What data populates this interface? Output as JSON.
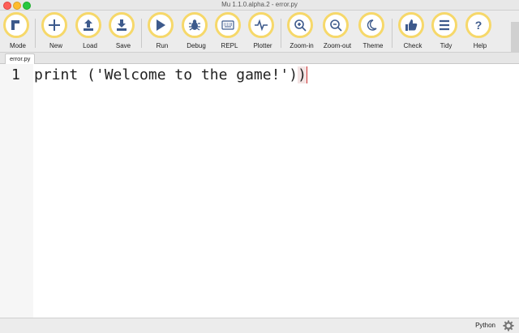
{
  "window": {
    "title": "Mu 1.1.0.alpha.2 - error.py"
  },
  "toolbar": {
    "buttons": [
      {
        "id": "mode",
        "label": "Mode",
        "icon": "mode-icon"
      },
      {
        "id": "new",
        "label": "New",
        "icon": "plus-icon"
      },
      {
        "id": "load",
        "label": "Load",
        "icon": "upload-icon"
      },
      {
        "id": "save",
        "label": "Save",
        "icon": "download-icon"
      },
      {
        "id": "run",
        "label": "Run",
        "icon": "play-icon"
      },
      {
        "id": "debug",
        "label": "Debug",
        "icon": "bug-icon"
      },
      {
        "id": "repl",
        "label": "REPL",
        "icon": "keyboard-icon"
      },
      {
        "id": "plotter",
        "label": "Plotter",
        "icon": "pulse-icon"
      },
      {
        "id": "zoom-in",
        "label": "Zoom-in",
        "icon": "zoom-in-icon"
      },
      {
        "id": "zoom-out",
        "label": "Zoom-out",
        "icon": "zoom-out-icon"
      },
      {
        "id": "theme",
        "label": "Theme",
        "icon": "moon-icon"
      },
      {
        "id": "check",
        "label": "Check",
        "icon": "thumbs-up-icon"
      },
      {
        "id": "tidy",
        "label": "Tidy",
        "icon": "lines-icon"
      },
      {
        "id": "help",
        "label": "Help",
        "icon": "question-icon"
      }
    ],
    "accent": "#f6d86a",
    "icon_color": "#3d5a8c"
  },
  "tabs": [
    {
      "label": "error.py"
    }
  ],
  "editor": {
    "lines": [
      {
        "number": "1",
        "code": "print ('Welcome to the game!')",
        "trailing": ")"
      }
    ]
  },
  "status": {
    "mode": "Python",
    "settings_icon": "gear-icon"
  }
}
